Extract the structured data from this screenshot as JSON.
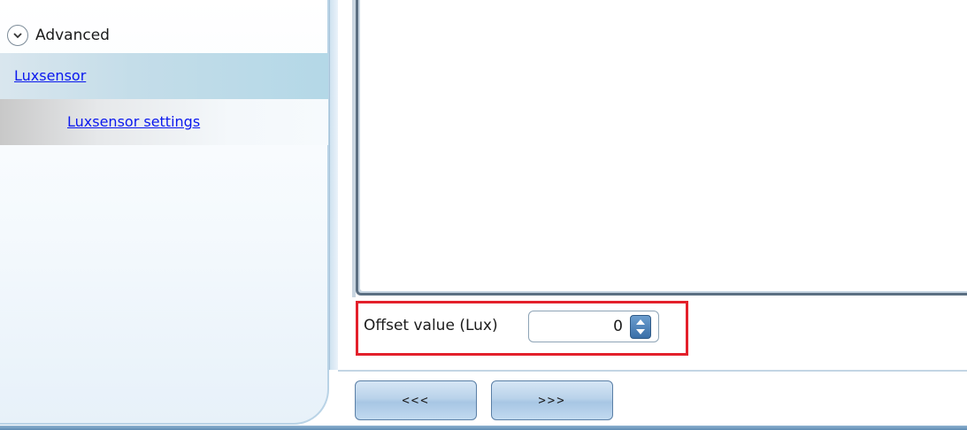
{
  "sidebar": {
    "advanced_label": "Advanced",
    "items": [
      {
        "label": "Luxsensor",
        "level": 0,
        "selected": true
      },
      {
        "label": "Luxsensor settings",
        "level": 1,
        "selected": false
      }
    ]
  },
  "form": {
    "offset_label": "Offset value (Lux)",
    "offset_value": "0"
  },
  "navigation": {
    "back_label": "<<<",
    "next_label": ">>>"
  },
  "colors": {
    "link": "#0a18ee",
    "highlight_border": "#e3202b",
    "selected_item_bg": "#b4d8e7",
    "spin_button": "#3a6fa8"
  }
}
